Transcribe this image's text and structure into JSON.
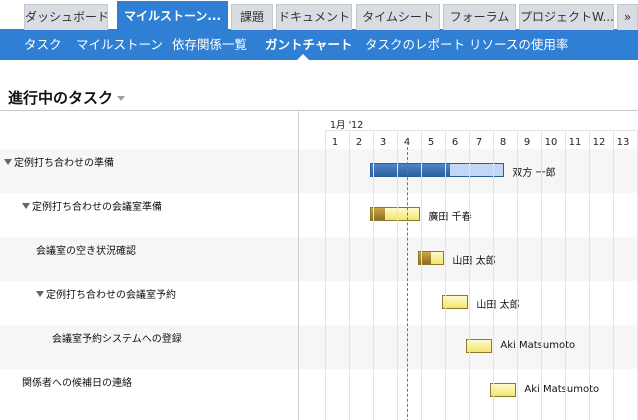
{
  "tabs": [
    {
      "label": "ダッシュボード"
    },
    {
      "label": "マイルストーン..."
    },
    {
      "label": "課題"
    },
    {
      "label": "ドキュメント"
    },
    {
      "label": "タイムシート"
    },
    {
      "label": "フォーラム"
    },
    {
      "label": "プロジェクトW..."
    },
    {
      "label": "»"
    }
  ],
  "active_tab_index": 1,
  "subnav": [
    {
      "label": "タスク"
    },
    {
      "label": "マイルストーン"
    },
    {
      "label": "依存関係一覧"
    },
    {
      "label": "ガントチャート"
    },
    {
      "label": "タスクのレポート"
    },
    {
      "label": "リソースの使用率"
    }
  ],
  "active_subnav_index": 3,
  "page_title": "進行中のタスク",
  "timeline": {
    "month": "1月 '12",
    "days": [
      "1",
      "2",
      "3",
      "4",
      "5",
      "6",
      "7",
      "8",
      "9",
      "10",
      "11",
      "12",
      "13"
    ],
    "today_day": 4
  },
  "tasks": [
    {
      "name": "定例打ち合わせの準備",
      "expandable": true,
      "indent": 0,
      "start": 2,
      "end": 7.6,
      "progress": 0.6,
      "color": "blue",
      "assignee": "双方 一郎"
    },
    {
      "name": "定例打ち合わせの会議室準備",
      "expandable": true,
      "indent": 1,
      "start": 2,
      "end": 4.1,
      "progress": 0.28,
      "color": "yellow",
      "assignee": "廣田 千春"
    },
    {
      "name": "会議室の空き状況確認",
      "expandable": false,
      "indent": 2,
      "start": 4,
      "end": 5.1,
      "progress": 0.5,
      "color": "yellow",
      "assignee": "山田 太郎"
    },
    {
      "name": "定例打ち合わせの会議室予約",
      "expandable": true,
      "indent": 2,
      "start": 5,
      "end": 6.1,
      "progress": 0,
      "color": "yellow",
      "assignee": "山田 太郎"
    },
    {
      "name": "会議室予約システムへの登録",
      "expandable": false,
      "indent": 3,
      "start": 6,
      "end": 7.1,
      "progress": 0,
      "color": "yellow",
      "assignee": "Aki Matsumoto"
    },
    {
      "name": "関係者への候補日の連絡",
      "expandable": false,
      "indent": 1,
      "start": 7,
      "end": 8.1,
      "progress": 0,
      "color": "yellow",
      "assignee": "Aki Matsumoto"
    }
  ],
  "colors": {
    "accent": "#2f7fd4",
    "tab_inactive": "#d9dde3",
    "today_line": "#3a9b3a"
  }
}
